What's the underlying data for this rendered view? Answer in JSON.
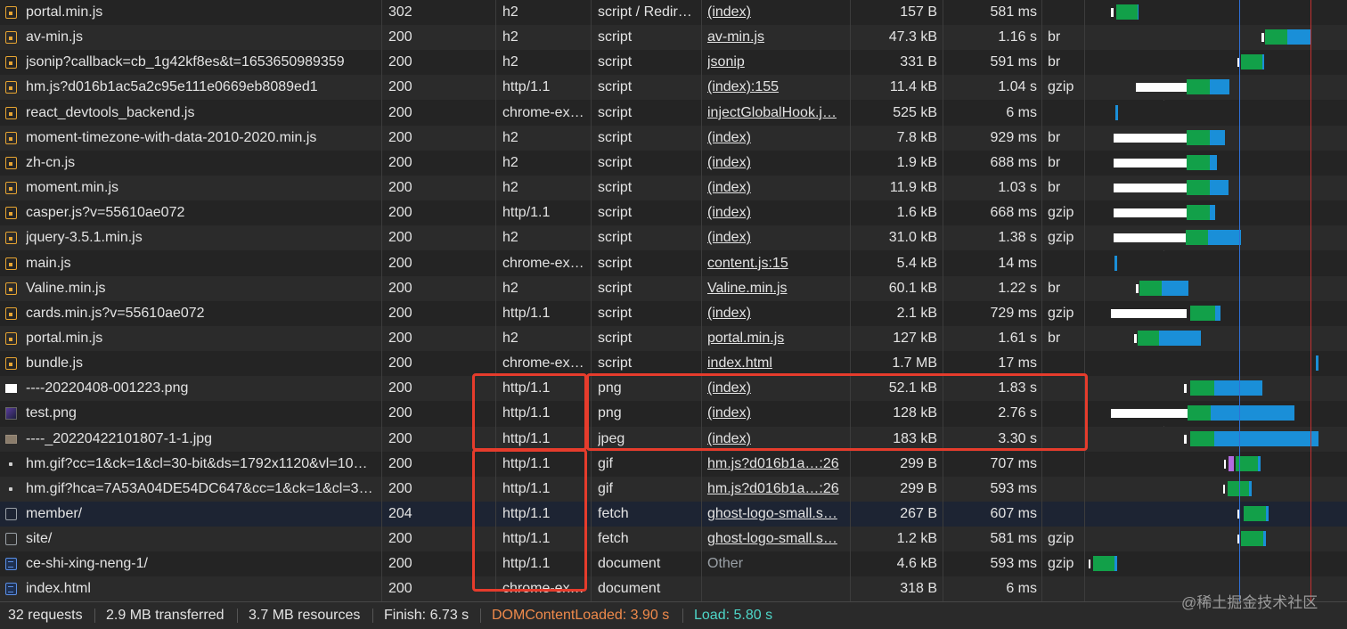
{
  "requests": [
    {
      "name": "portal.min.js",
      "status": "302",
      "protocol": "h2",
      "type": "script / Redir…",
      "initiator": "(index)",
      "size": "157 B",
      "time": "581 ms",
      "encoding": "",
      "icon": "script-icon"
    },
    {
      "name": "av-min.js",
      "status": "200",
      "protocol": "h2",
      "type": "script",
      "initiator": "av-min.js",
      "size": "47.3 kB",
      "time": "1.16 s",
      "encoding": "br",
      "icon": "script-icon"
    },
    {
      "name": "jsonip?callback=cb_1g42kf8es&t=1653650989359",
      "status": "200",
      "protocol": "h2",
      "type": "script",
      "initiator": "jsonip",
      "size": "331 B",
      "time": "591 ms",
      "encoding": "br",
      "icon": "script-icon"
    },
    {
      "name": "hm.js?d016b1ac5a2c95e111e0669eb8089ed1",
      "status": "200",
      "protocol": "http/1.1",
      "type": "script",
      "initiator": "(index):155",
      "size": "11.4 kB",
      "time": "1.04 s",
      "encoding": "gzip",
      "icon": "script-icon"
    },
    {
      "name": "react_devtools_backend.js",
      "status": "200",
      "protocol": "chrome-ex…",
      "type": "script",
      "initiator": "injectGlobalHook.j…",
      "size": "525 kB",
      "time": "6 ms",
      "encoding": "",
      "icon": "script-icon"
    },
    {
      "name": "moment-timezone-with-data-2010-2020.min.js",
      "status": "200",
      "protocol": "h2",
      "type": "script",
      "initiator": "(index)",
      "size": "7.8 kB",
      "time": "929 ms",
      "encoding": "br",
      "icon": "script-icon"
    },
    {
      "name": "zh-cn.js",
      "status": "200",
      "protocol": "h2",
      "type": "script",
      "initiator": "(index)",
      "size": "1.9 kB",
      "time": "688 ms",
      "encoding": "br",
      "icon": "script-icon"
    },
    {
      "name": "moment.min.js",
      "status": "200",
      "protocol": "h2",
      "type": "script",
      "initiator": "(index)",
      "size": "11.9 kB",
      "time": "1.03 s",
      "encoding": "br",
      "icon": "script-icon"
    },
    {
      "name": "casper.js?v=55610ae072",
      "status": "200",
      "protocol": "http/1.1",
      "type": "script",
      "initiator": "(index)",
      "size": "1.6 kB",
      "time": "668 ms",
      "encoding": "gzip",
      "icon": "script-icon"
    },
    {
      "name": "jquery-3.5.1.min.js",
      "status": "200",
      "protocol": "h2",
      "type": "script",
      "initiator": "(index)",
      "size": "31.0 kB",
      "time": "1.38 s",
      "encoding": "gzip",
      "icon": "script-icon"
    },
    {
      "name": "main.js",
      "status": "200",
      "protocol": "chrome-ex…",
      "type": "script",
      "initiator": "content.js:15",
      "size": "5.4 kB",
      "time": "14 ms",
      "encoding": "",
      "icon": "script-icon"
    },
    {
      "name": "Valine.min.js",
      "status": "200",
      "protocol": "h2",
      "type": "script",
      "initiator": "Valine.min.js",
      "size": "60.1 kB",
      "time": "1.22 s",
      "encoding": "br",
      "icon": "script-icon"
    },
    {
      "name": "cards.min.js?v=55610ae072",
      "status": "200",
      "protocol": "http/1.1",
      "type": "script",
      "initiator": "(index)",
      "size": "2.1 kB",
      "time": "729 ms",
      "encoding": "gzip",
      "icon": "script-icon"
    },
    {
      "name": "portal.min.js",
      "status": "200",
      "protocol": "h2",
      "type": "script",
      "initiator": "portal.min.js",
      "size": "127 kB",
      "time": "1.61 s",
      "encoding": "br",
      "icon": "script-icon"
    },
    {
      "name": "bundle.js",
      "status": "200",
      "protocol": "chrome-ex…",
      "type": "script",
      "initiator": "index.html",
      "size": "1.7 MB",
      "time": "17 ms",
      "encoding": "",
      "icon": "script-icon"
    },
    {
      "name": "----20220408-001223.png",
      "status": "200",
      "protocol": "http/1.1",
      "type": "png",
      "initiator": "(index)",
      "size": "52.1 kB",
      "time": "1.83 s",
      "encoding": "",
      "icon": "image-white-icon"
    },
    {
      "name": "test.png",
      "status": "200",
      "protocol": "http/1.1",
      "type": "png",
      "initiator": "(index)",
      "size": "128 kB",
      "time": "2.76 s",
      "encoding": "",
      "icon": "image-thumbnail-icon"
    },
    {
      "name": "----_20220422101807-1-1.jpg",
      "status": "200",
      "protocol": "http/1.1",
      "type": "jpeg",
      "initiator": "(index)",
      "size": "183 kB",
      "time": "3.30 s",
      "encoding": "",
      "icon": "jpeg-thumbnail-icon"
    },
    {
      "name": "hm.gif?cc=1&ck=1&cl=30-bit&ds=1792x1120&vl=10…",
      "status": "200",
      "protocol": "http/1.1",
      "type": "gif",
      "initiator": "hm.js?d016b1a…:26",
      "size": "299 B",
      "time": "707 ms",
      "encoding": "",
      "icon": "gif-dot-icon"
    },
    {
      "name": "hm.gif?hca=7A53A04DE54DC647&cc=1&ck=1&cl=3…",
      "status": "200",
      "protocol": "http/1.1",
      "type": "gif",
      "initiator": "hm.js?d016b1a…:26",
      "size": "299 B",
      "time": "593 ms",
      "encoding": "",
      "icon": "gif-dot-icon"
    },
    {
      "name": "member/",
      "status": "204",
      "protocol": "http/1.1",
      "type": "fetch",
      "initiator": "ghost-logo-small.s…",
      "size": "267 B",
      "time": "607 ms",
      "encoding": "",
      "icon": "fetch-file-icon"
    },
    {
      "name": "site/",
      "status": "200",
      "protocol": "http/1.1",
      "type": "fetch",
      "initiator": "ghost-logo-small.s…",
      "size": "1.2 kB",
      "time": "581 ms",
      "encoding": "gzip",
      "icon": "fetch-file-icon"
    },
    {
      "name": "ce-shi-xing-neng-1/",
      "status": "200",
      "protocol": "http/1.1",
      "type": "document",
      "initiator": "Other",
      "size": "4.6 kB",
      "time": "593 ms",
      "encoding": "gzip",
      "icon": "document-icon"
    },
    {
      "name": "index.html",
      "status": "200",
      "protocol": "chrome-ex…",
      "type": "document",
      "initiator": "",
      "size": "318 B",
      "time": "6 ms",
      "encoding": "",
      "icon": "document-icon"
    }
  ],
  "footer": {
    "requests": "32 requests",
    "transferred": "2.9 MB transferred",
    "resources": "3.7 MB resources",
    "finish": "Finish: 6.73 s",
    "dom_content_loaded": "DOMContentLoaded: 3.90 s",
    "load": "Load: 5.80 s"
  },
  "watermark": "@稀土掘金技术社区",
  "colors": {
    "waiting": "#ffffff",
    "ttfb": "#12a049",
    "download": "#1a8fd8",
    "dom_content_loaded": "#f08a4b",
    "load": "#4ed6c8",
    "annotation_box": "#e63c2c"
  }
}
